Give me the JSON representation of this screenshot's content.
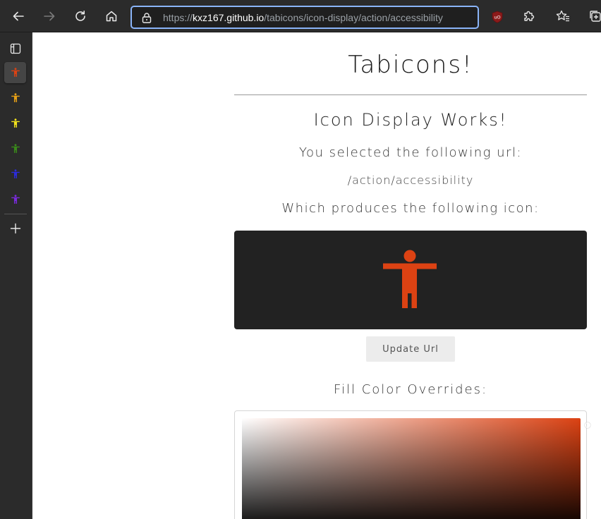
{
  "browser": {
    "url_host": "kxz167.github.io",
    "url_prefix": "https://",
    "url_path": "/tabicons/icon-display/action/accessibility",
    "extension_badge": "uO"
  },
  "sidebar": {
    "tab_icon_colors": [
      "#dc4213",
      "#e6a017",
      "#f2e21b",
      "#3a8a1a",
      "#2b2bdc",
      "#7a2bdc"
    ]
  },
  "page": {
    "title": "Tabicons!",
    "subtitle": "Icon Display Works!",
    "selected_label": "You selected the following url:",
    "selected_url": "/action/accessibility",
    "produces_label": "Which produces the following icon:",
    "icon_name": "accessibility-icon",
    "icon_color": "#dc4213",
    "update_button": "Update Url",
    "fill_title": "Fill Color Overrides:"
  }
}
